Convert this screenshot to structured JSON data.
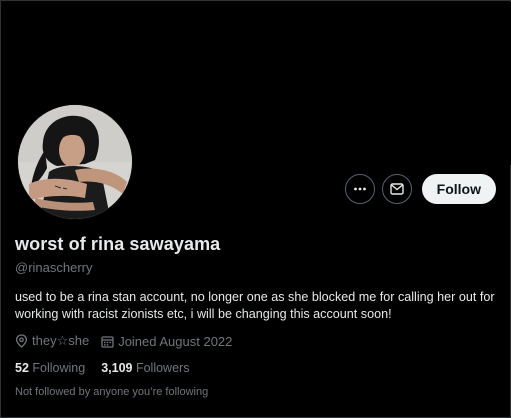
{
  "profile": {
    "display_name": "worst of rina sawayama",
    "handle": "@rinascherry",
    "bio": "used to be a rina stan account, no longer one as she blocked me for calling her out for working with racist zionists etc, i will be changing this account soon!",
    "pronouns": "they☆she",
    "joined": "Joined August 2022"
  },
  "actions": {
    "more_icon": "more-horizontal-icon",
    "message_icon": "envelope-icon",
    "follow_label": "Follow"
  },
  "stats": {
    "following_count": "52",
    "following_label": "Following",
    "followers_count": "3,109",
    "followers_label": "Followers"
  },
  "note": "Not followed by anyone you’re following",
  "colors": {
    "background": "#000000",
    "text_primary": "#e7e9ea",
    "text_secondary": "#71767b",
    "follow_bg": "#eff3f4",
    "border": "#536471"
  }
}
